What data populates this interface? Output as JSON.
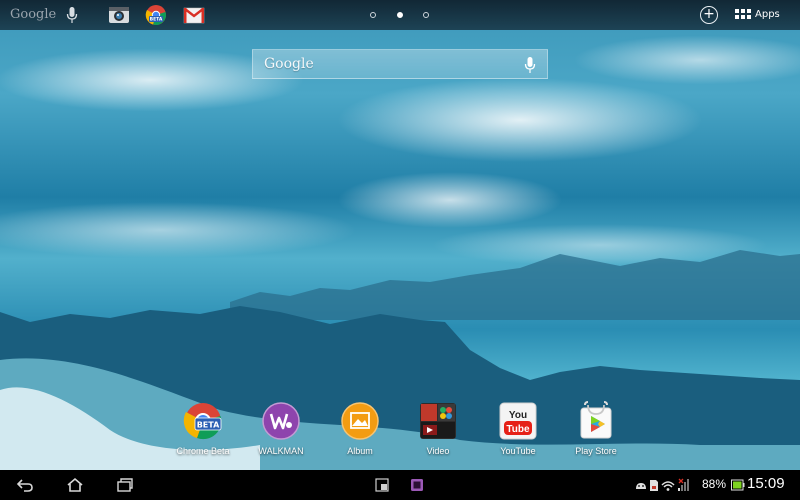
{
  "top_bar": {
    "google_label": "Google",
    "apps_label": "Apps",
    "shortcuts": [
      "camera-app-icon",
      "chrome-beta-app-icon",
      "gmail-app-icon"
    ],
    "page_indicator": {
      "count": 3,
      "current": 2
    }
  },
  "search_widget": {
    "label": "Google"
  },
  "dock": {
    "items": [
      {
        "label": "Chrome Beta",
        "icon": "chrome-beta-icon"
      },
      {
        "label": "WALKMAN",
        "icon": "walkman-icon"
      },
      {
        "label": "Album",
        "icon": "album-icon"
      },
      {
        "label": "Video",
        "icon": "video-icon"
      },
      {
        "label": "YouTube",
        "icon": "youtube-icon"
      },
      {
        "label": "Play Store",
        "icon": "play-store-icon"
      }
    ]
  },
  "status_bar": {
    "battery_percent": "88%",
    "time": "15:09"
  },
  "colors": {
    "top_bar_bg": "#0a141e",
    "bottom_bar_bg": "#000000",
    "sky_blue": "#3c97b9",
    "accent_green": "#7ed321"
  }
}
